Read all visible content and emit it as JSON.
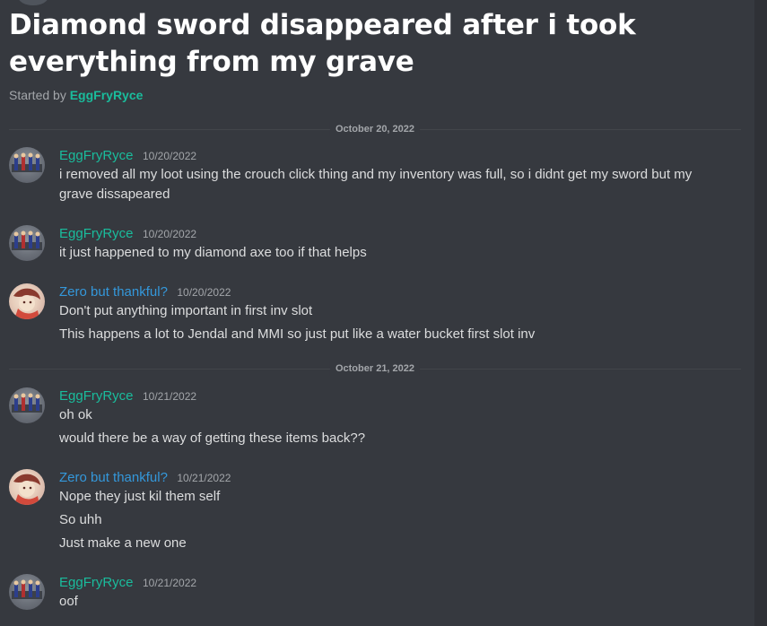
{
  "thread": {
    "title": "Diamond sword disappeared after i took everything from my grave",
    "started_by_label": "Started by",
    "started_by_user": "EggFryRyce"
  },
  "dividers": [
    {
      "label": "October 20, 2022"
    },
    {
      "label": "October 21, 2022"
    }
  ],
  "messages": [
    {
      "author": "EggFryRyce",
      "timestamp": "10/20/2022",
      "lines": [
        "i removed all my loot using the crouch click thing and my inventory was full, so i didnt get my sword but my grave dissapeared"
      ]
    },
    {
      "author": "EggFryRyce",
      "timestamp": "10/20/2022",
      "lines": [
        "it just happened to my diamond axe too if that helps"
      ]
    },
    {
      "author": "Zero but thankful?",
      "timestamp": "10/20/2022",
      "lines": [
        "Don't put anything important in first inv slot",
        "This happens a lot to Jendal and MMI so just put like a water bucket first slot inv"
      ]
    },
    {
      "author": "EggFryRyce",
      "timestamp": "10/21/2022",
      "lines": [
        "oh ok",
        "would there be a way of getting these items back??"
      ]
    },
    {
      "author": "Zero but thankful?",
      "timestamp": "10/21/2022",
      "lines": [
        "Nope they just kil them self",
        "So uhh",
        "Just make a new one"
      ]
    },
    {
      "author": "EggFryRyce",
      "timestamp": "10/21/2022",
      "lines": [
        "oof"
      ]
    }
  ],
  "colors": {
    "background": "#36393f",
    "egg_name": "#1abc9c",
    "zero_name": "#3498db",
    "message_text": "#dcddde",
    "muted_text": "#a3a6aa"
  }
}
